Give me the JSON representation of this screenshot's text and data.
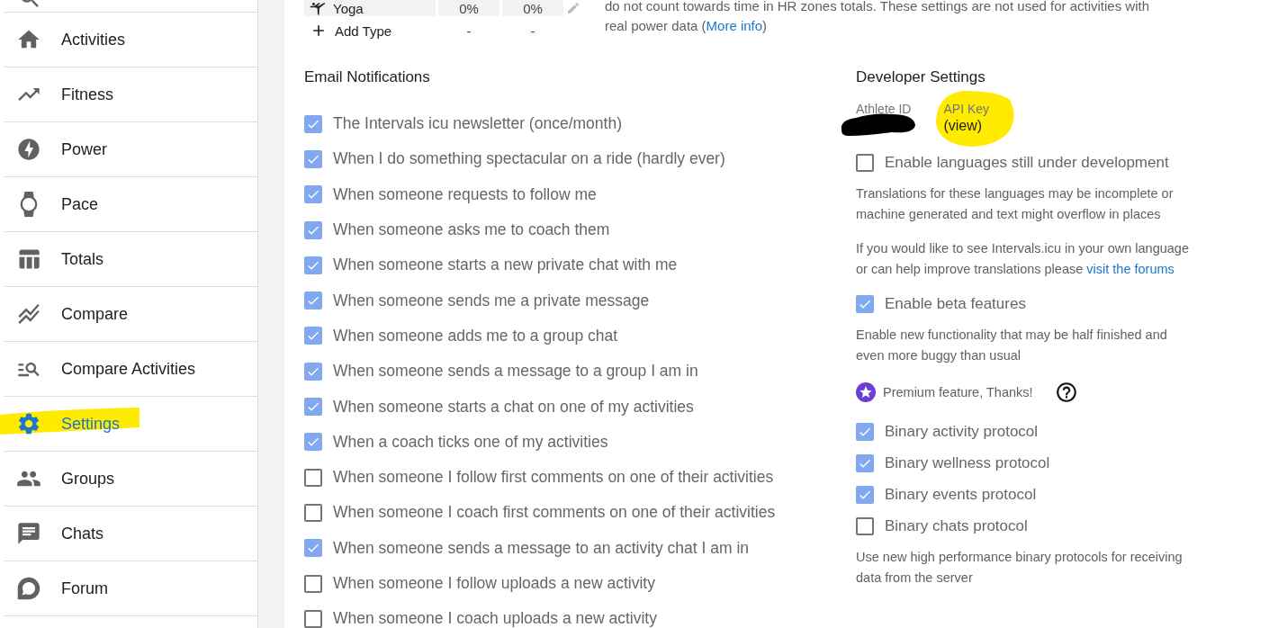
{
  "sidebar": {
    "items": [
      {
        "label": "Activities",
        "selected": false
      },
      {
        "label": "Fitness",
        "selected": false
      },
      {
        "label": "Power",
        "selected": false
      },
      {
        "label": "Pace",
        "selected": false
      },
      {
        "label": "Totals",
        "selected": false
      },
      {
        "label": "Compare",
        "selected": false
      },
      {
        "label": "Compare Activities",
        "selected": false
      },
      {
        "label": "Settings",
        "selected": true
      },
      {
        "label": "Groups",
        "selected": false
      },
      {
        "label": "Chats",
        "selected": false
      },
      {
        "label": "Forum",
        "selected": false
      }
    ]
  },
  "sport_table": {
    "rows": [
      {
        "kind": "sport",
        "name": "Yoga",
        "column_2": "0%",
        "column_3": "0%"
      },
      {
        "kind": "add",
        "name": "Add Type",
        "column_2": "-",
        "column_3": "-"
      }
    ]
  },
  "power_note": {
    "text": "do not count towards time in HR zones totals. These settings are not used for activities with real power data (",
    "link": "More info",
    "after": ")"
  },
  "email_notifications": {
    "title": "Email Notifications",
    "items": [
      {
        "label": "The Intervals icu newsletter (once/month)",
        "checked": true
      },
      {
        "label": "When I do something spectacular on a ride (hardly ever)",
        "checked": true
      },
      {
        "label": "When someone requests to follow me",
        "checked": true
      },
      {
        "label": "When someone asks me to coach them",
        "checked": true
      },
      {
        "label": "When someone starts a new private chat with me",
        "checked": true
      },
      {
        "label": "When someone sends me a private message",
        "checked": true
      },
      {
        "label": "When someone adds me to a group chat",
        "checked": true
      },
      {
        "label": "When someone sends a message to a group I am in",
        "checked": true
      },
      {
        "label": "When someone starts a chat on one of my activities",
        "checked": true
      },
      {
        "label": "When a coach ticks one of my activities",
        "checked": true
      },
      {
        "label": "When someone I follow first comments on one of their activities",
        "checked": false
      },
      {
        "label": "When someone I coach first comments on one of their activities",
        "checked": false
      },
      {
        "label": "When someone sends a message to an activity chat I am in",
        "checked": true
      },
      {
        "label": "When someone I follow uploads a new activity",
        "checked": false
      },
      {
        "label": "When someone I coach uploads a new activity",
        "checked": false
      }
    ]
  },
  "developer_settings": {
    "title": "Developer Settings",
    "athlete_id_label": "Athlete ID",
    "api_key_label": "API Key",
    "api_key_value": "(view)",
    "items": [
      {
        "kind": "checkbox",
        "label": "Enable languages still under development",
        "checked": false
      },
      {
        "kind": "text",
        "text": "Translations for these languages may be incomplete or machine generated and text might overflow in places"
      },
      {
        "kind": "text_link",
        "text": "If you would like to see Intervals.icu in your own language or can help improve translations please ",
        "link": "visit the forums"
      },
      {
        "kind": "checkbox",
        "label": "Enable beta features",
        "checked": true
      },
      {
        "kind": "text",
        "text": "Enable new functionality that may be half finished and even more buggy than usual"
      },
      {
        "kind": "premium",
        "text": "Premium feature, Thanks!"
      },
      {
        "kind": "checkbox",
        "label": "Binary activity protocol",
        "checked": true
      },
      {
        "kind": "checkbox",
        "label": "Binary wellness protocol",
        "checked": true
      },
      {
        "kind": "checkbox",
        "label": "Binary events protocol",
        "checked": true
      },
      {
        "kind": "checkbox",
        "label": "Binary chats protocol",
        "checked": false
      },
      {
        "kind": "text",
        "text": "Use new high performance binary protocols for receiving data from the server"
      }
    ]
  }
}
